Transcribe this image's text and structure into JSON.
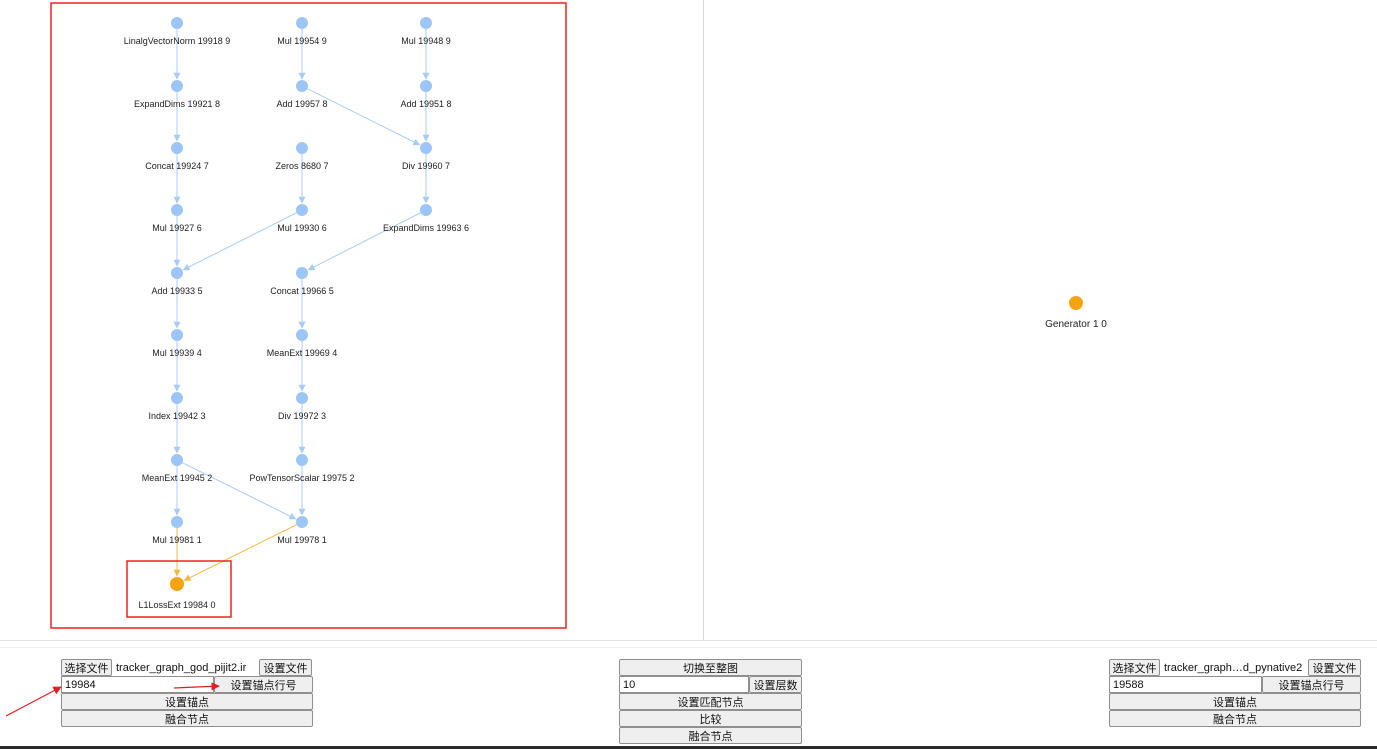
{
  "colors": {
    "node_default": "#9ec5f7",
    "node_anchor": "#f5a30f",
    "edge_default": "#a9ccf5",
    "edge_anchor": "#f5b845",
    "highlight_box": "#ee2222",
    "arrow_annotation": "#e02020"
  },
  "left_graph": {
    "nodes": [
      {
        "label": "LinalgVectorNorm 19918 9"
      },
      {
        "label": "Mul 19954 9"
      },
      {
        "label": "Mul 19948 9"
      },
      {
        "label": "ExpandDims 19921 8"
      },
      {
        "label": "Add 19957 8"
      },
      {
        "label": "Add 19951 8"
      },
      {
        "label": "Concat 19924 7"
      },
      {
        "label": "Zeros 8680 7"
      },
      {
        "label": "Div 19960 7"
      },
      {
        "label": "Mul 19927 6"
      },
      {
        "label": "Mul 19930 6"
      },
      {
        "label": "ExpandDims 19963 6"
      },
      {
        "label": "Add 19933 5"
      },
      {
        "label": "Concat 19966 5"
      },
      {
        "label": "Mul 19939 4"
      },
      {
        "label": "MeanExt 19969 4"
      },
      {
        "label": "Index 19942 3"
      },
      {
        "label": "Div 19972 3"
      },
      {
        "label": "MeanExt 19945 2"
      },
      {
        "label": "PowTensorScalar 19975 2"
      },
      {
        "label": "Mul 19981 1"
      },
      {
        "label": "Mul 19978 1"
      },
      {
        "label": "L1LossExt 19984 0",
        "anchor": true
      }
    ],
    "edges": [
      [
        0,
        3
      ],
      [
        3,
        6
      ],
      [
        6,
        9
      ],
      [
        9,
        12
      ],
      [
        12,
        14
      ],
      [
        14,
        16
      ],
      [
        16,
        18
      ],
      [
        18,
        20
      ],
      [
        1,
        4
      ],
      [
        4,
        8
      ],
      [
        2,
        5
      ],
      [
        5,
        8
      ],
      [
        8,
        11
      ],
      [
        11,
        13
      ],
      [
        7,
        10
      ],
      [
        10,
        12
      ],
      [
        13,
        15
      ],
      [
        15,
        17
      ],
      [
        17,
        19
      ],
      [
        19,
        21
      ],
      [
        18,
        21
      ],
      {
        "from": 20,
        "to": 22,
        "anchor": true
      },
      {
        "from": 21,
        "to": 22,
        "anchor": true
      }
    ]
  },
  "right_graph": {
    "nodes": [
      {
        "label": "Generator 1 0",
        "anchor": true
      }
    ],
    "edges": []
  },
  "left_panel": {
    "choose_file": "选择文件",
    "file_name": "tracker_graph_god_pijit2.ir",
    "set_file": "设置文件",
    "anchor_line_value": "19984",
    "set_anchor_line": "设置锚点行号",
    "set_anchor": "设置锚点",
    "merge_nodes": "融合节点"
  },
  "center_panel": {
    "switch_full_graph": "切换至整图",
    "layer_value": "10",
    "set_layers": "设置层数",
    "set_match_nodes": "设置匹配节点",
    "compare": "比较",
    "merge_nodes": "融合节点"
  },
  "right_panel": {
    "choose_file": "选择文件",
    "file_name": "tracker_graph…d_pynative2.ir",
    "set_file": "设置文件",
    "anchor_line_value": "19588",
    "set_anchor_line": "设置锚点行号",
    "set_anchor": "设置锚点",
    "merge_nodes": "融合节点"
  }
}
